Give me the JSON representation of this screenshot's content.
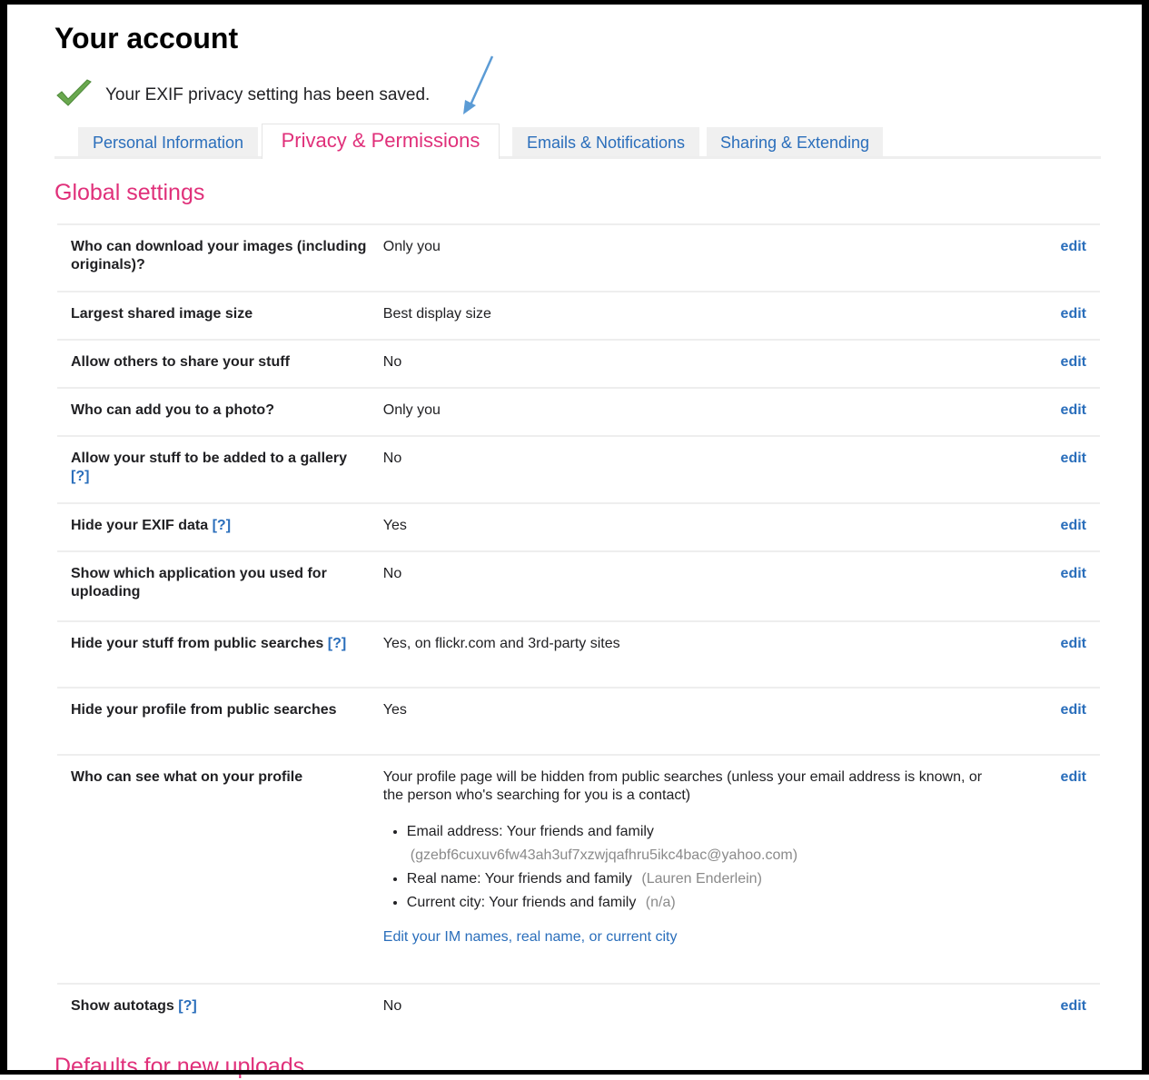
{
  "page": {
    "title": "Your account",
    "notice": "Your EXIF privacy setting has been saved."
  },
  "tabs": [
    {
      "label": "Personal Information",
      "active": false
    },
    {
      "label": "Privacy & Permissions",
      "active": true
    },
    {
      "label": "Emails & Notifications",
      "active": false
    },
    {
      "label": "Sharing & Extending",
      "active": false
    }
  ],
  "global": {
    "title": "Global settings",
    "edit_label": "edit",
    "help_label": "[?]",
    "rows": [
      {
        "label": "Who can download your images (including originals)?",
        "value": "Only you"
      },
      {
        "label": "Largest shared image size",
        "value": "Best display size"
      },
      {
        "label": "Allow others to share your stuff",
        "value": "No"
      },
      {
        "label": "Who can add you to a photo?",
        "value": "Only you"
      },
      {
        "label": "Allow your stuff to be added to a gallery",
        "value": "No"
      },
      {
        "label": "Hide your EXIF data",
        "value": "Yes"
      },
      {
        "label": "Show which application you used for uploading",
        "value": "No"
      },
      {
        "label": "Hide your stuff from public searches",
        "value": "Yes, on flickr.com and 3rd-party sites"
      },
      {
        "label": "Hide your profile from public searches",
        "value": "Yes"
      },
      {
        "label": "Who can see what on your profile",
        "value": "Your profile page will be hidden from public searches (unless your email address is known, or the person who's searching for you is a contact)"
      },
      {
        "label": "Show autotags",
        "value": "No"
      }
    ],
    "profile_items": [
      {
        "text": "Email address: Your friends and family",
        "detail": "(gzebf6cuxuv6fw43ah3uf7xzwjqafhru5ikc4bac@yahoo.com)"
      },
      {
        "text": "Real name: Your friends and family",
        "detail": "(Lauren Enderlein)"
      },
      {
        "text": "Current city: Your friends and family",
        "detail": "(n/a)"
      }
    ],
    "profile_link": "Edit your IM names, real name, or current city"
  },
  "defaults": {
    "title": "Defaults for new uploads"
  },
  "colors": {
    "accent": "#e0307a",
    "link": "#2a6ebb",
    "check": "#6aa84f",
    "arrow": "#5b9bd5"
  }
}
